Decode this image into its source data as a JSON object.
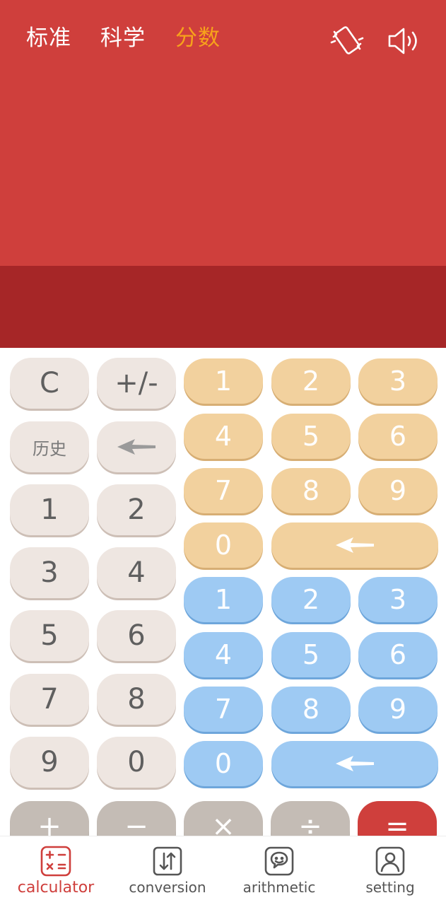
{
  "modes": [
    {
      "label": "标准",
      "active": false
    },
    {
      "label": "科学",
      "active": false
    },
    {
      "label": "分数",
      "active": true
    }
  ],
  "top_icons": {
    "vibrate": "vibrate-icon",
    "sound": "speaker-icon"
  },
  "colors": {
    "primary": "#cf3f3c",
    "primary_dark": "#a62627",
    "active_tab": "#f7a21b",
    "key_gray": "#eee6e1",
    "key_orange": "#f2d19e",
    "key_blue": "#9ecaf3",
    "key_op": "#c4bcb5"
  },
  "left_keys": {
    "clear": "C",
    "sign": "+/-",
    "history": "历史",
    "digits": [
      "1",
      "2",
      "3",
      "4",
      "5",
      "6",
      "7",
      "8",
      "9",
      "0"
    ]
  },
  "numerator_keys": [
    "1",
    "2",
    "3",
    "4",
    "5",
    "6",
    "7",
    "8",
    "9",
    "0"
  ],
  "denominator_keys": [
    "1",
    "2",
    "3",
    "4",
    "5",
    "6",
    "7",
    "8",
    "9",
    "0"
  ],
  "operators": [
    "+",
    "−",
    "×",
    "÷",
    "="
  ],
  "nav": [
    {
      "label": "calculator",
      "icon": "calculator-icon",
      "active": true
    },
    {
      "label": "conversion",
      "icon": "conversion-icon",
      "active": false
    },
    {
      "label": "arithmetic",
      "icon": "chat-smile-icon",
      "active": false
    },
    {
      "label": "setting",
      "icon": "person-icon",
      "active": false
    }
  ]
}
